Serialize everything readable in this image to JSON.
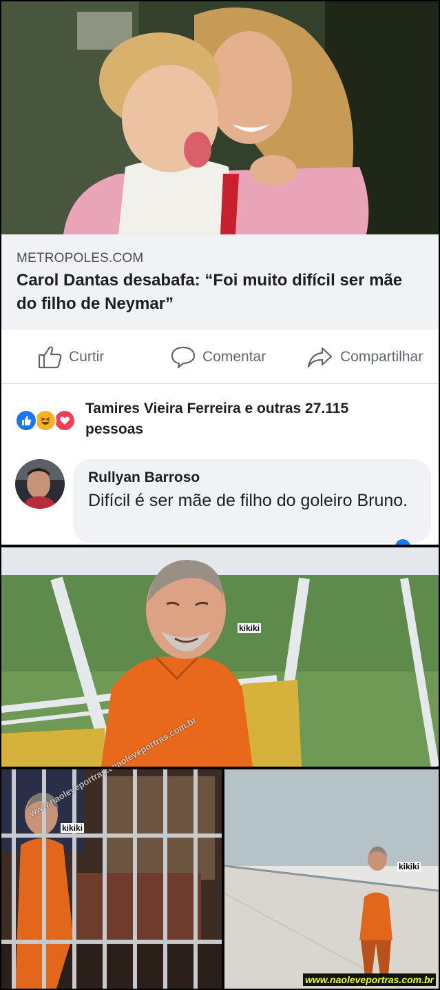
{
  "post": {
    "link_domain": "METROPOLES.COM",
    "link_title": "Carol Dantas desabafa: “Foi muito difícil ser mãe do filho de Neymar”"
  },
  "actions": {
    "like": "Curtir",
    "comment": "Comentar",
    "share": "Compartilhar"
  },
  "reactions": {
    "text": "Tamires Vieira Ferreira e outras 27.115 pessoas",
    "icons": [
      "like-icon",
      "haha-icon",
      "love-icon"
    ]
  },
  "comment": {
    "author": "Rullyan Barroso",
    "text": "Difícil é ser mãe de filho do goleiro Bruno."
  },
  "memes": {
    "caption_1": "kikiki",
    "caption_2": "kikiki",
    "caption_3": "kikiki",
    "watermark_diagonal": "www.naoleveportras.com.br",
    "watermark_bottom": "www.naoleveportras.com.br"
  },
  "colors": {
    "facebook_blue": "#1877f2",
    "love_red": "#f33e58",
    "haha_yellow": "#f7b125",
    "prison_orange": "#e8691c"
  }
}
